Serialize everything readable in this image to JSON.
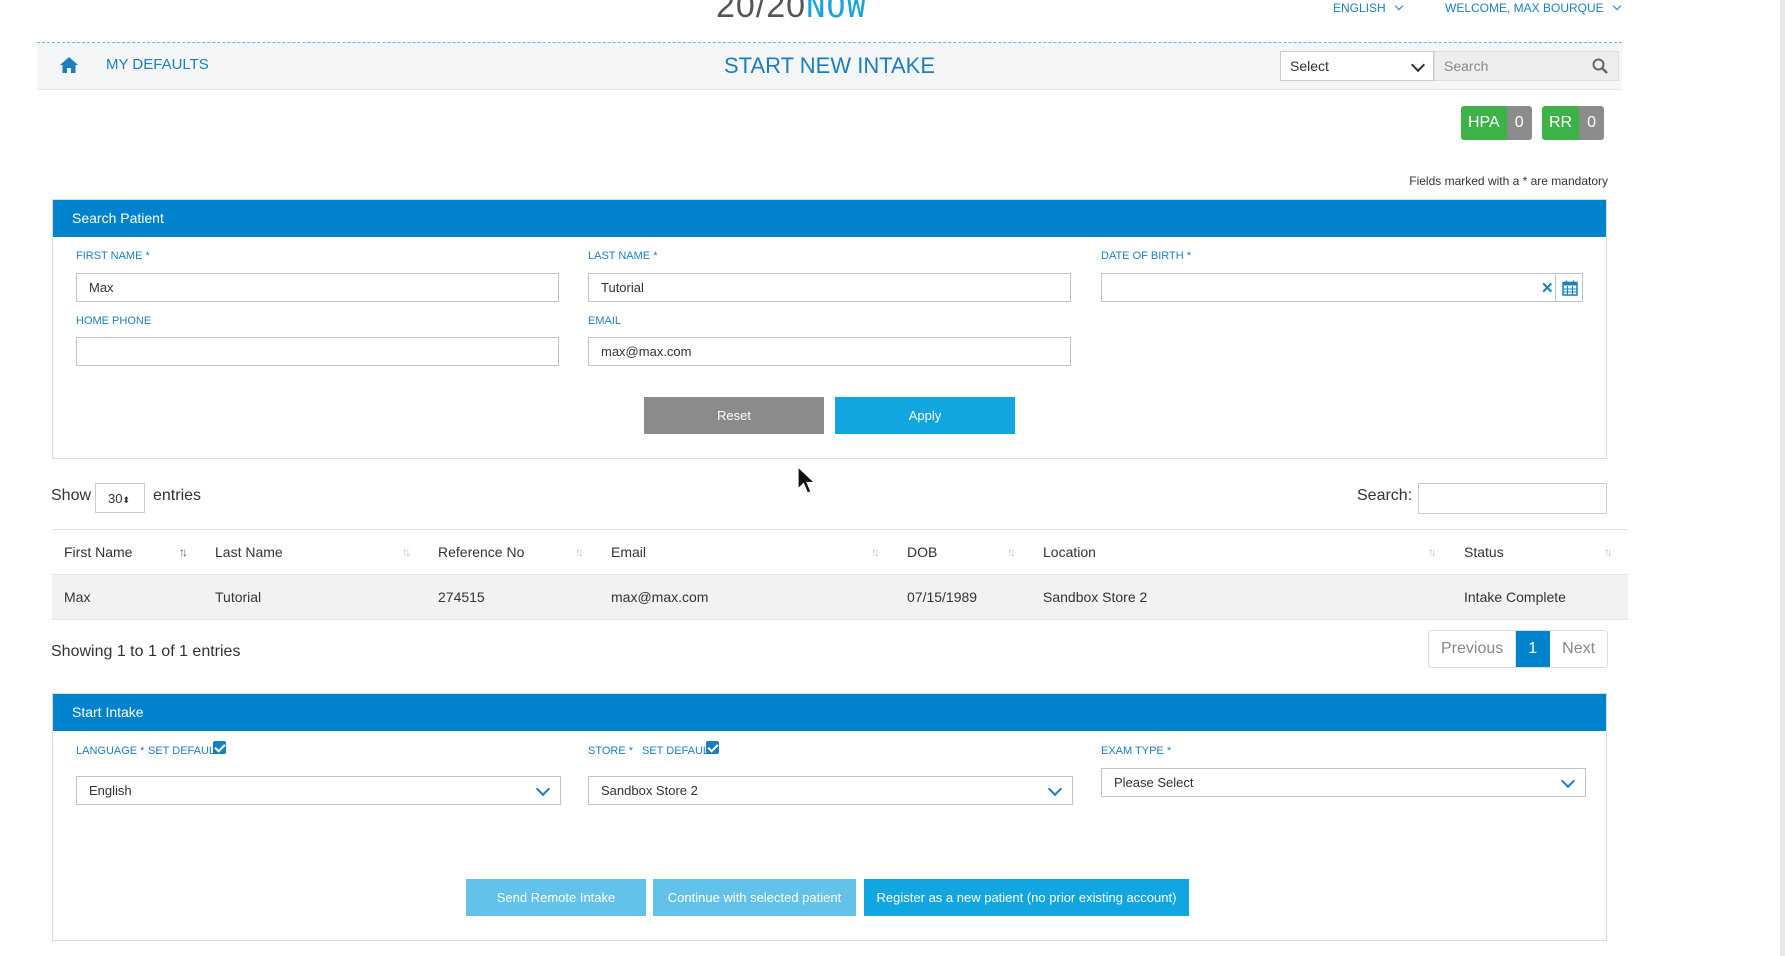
{
  "header": {
    "logo_part1": "20/20",
    "logo_part2": "NOW",
    "language": "ENGLISH",
    "welcome": "WELCOME, MAX BOURQUE"
  },
  "navbar": {
    "my_defaults": "MY DEFAULTS",
    "title": "START NEW INTAKE",
    "select_value": "Select",
    "search_placeholder": "Search"
  },
  "badges": [
    {
      "label": "HPA",
      "count": "0"
    },
    {
      "label": "RR",
      "count": "0"
    }
  ],
  "mandatory_note": "Fields marked with a * are mandatory",
  "search_patient": {
    "title": "Search Patient",
    "first_name_label": "FIRST NAME *",
    "first_name_value": "Max",
    "last_name_label": "LAST NAME *",
    "last_name_value": "Tutorial",
    "dob_label": "DATE OF BIRTH *",
    "dob_value": "",
    "home_phone_label": "HOME PHONE",
    "home_phone_value": "",
    "email_label": "EMAIL",
    "email_value": "max@max.com",
    "reset_label": "Reset",
    "apply_label": "Apply"
  },
  "results": {
    "show_label": "Show",
    "page_size": "30",
    "entries_label": "entries",
    "search_label": "Search:",
    "columns": [
      "First Name",
      "Last Name",
      "Reference No",
      "Email",
      "DOB",
      "Location",
      "Status"
    ],
    "rows": [
      [
        "Max",
        "Tutorial",
        "274515",
        "max@max.com",
        "07/15/1989",
        "Sandbox Store 2",
        "Intake Complete"
      ]
    ],
    "showing_text": "Showing 1 to 1 of 1 entries",
    "pager": {
      "previous": "Previous",
      "current": "1",
      "next": "Next"
    }
  },
  "start_intake": {
    "title": "Start Intake",
    "language_label": "LANGUAGE *",
    "set_default_label": "SET DEFAULT",
    "language_value": "English",
    "store_label": "STORE *",
    "store_value": "Sandbox Store 2",
    "exam_type_label": "EXAM TYPE *",
    "exam_type_value": "Please Select",
    "send_remote_label": "Send Remote Intake",
    "continue_label": "Continue with selected patient",
    "register_label": "Register as a new patient (no prior existing account)"
  },
  "colors": {
    "primary": "#0083cc",
    "accent": "#1a7fc1",
    "badge_green": "#3db249",
    "reset_gray": "#8a8b8c",
    "apply_blue": "#12a6e0",
    "disabled_blue": "#63c2ea"
  }
}
